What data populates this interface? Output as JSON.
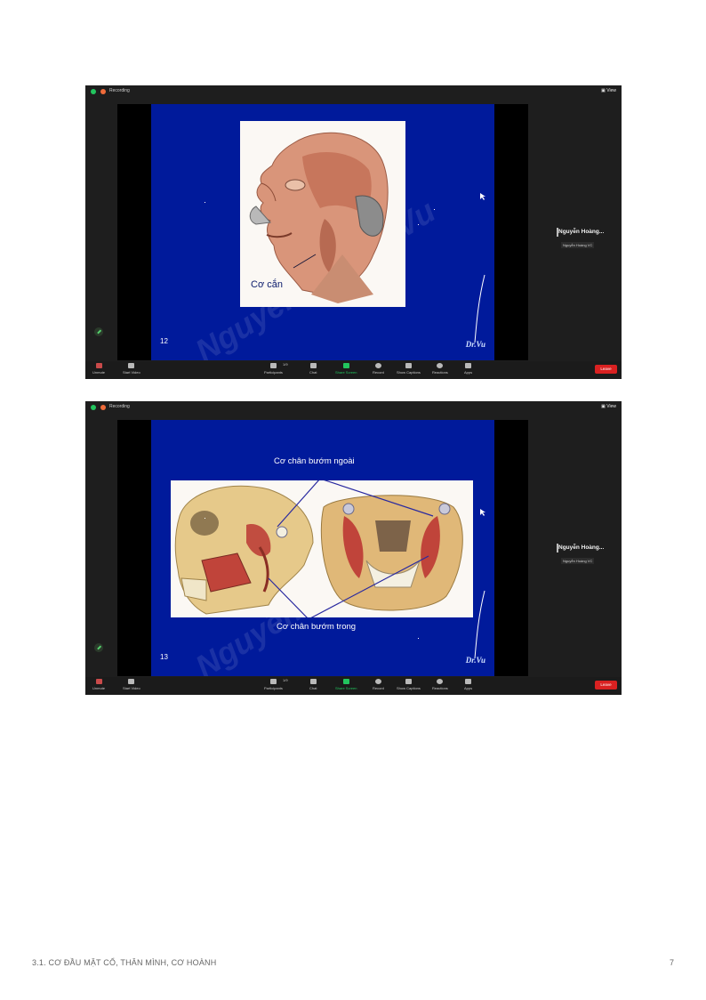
{
  "screens": [
    {
      "recording_label": "Recording",
      "view_label": "View",
      "slide_number": "12",
      "slide_caption": "Cơ cắn",
      "watermark": "Nguyễn Hoàng Vu",
      "signature": "Dr.Vu",
      "participant_name": "Nguyễn Hoàng...",
      "participant_sub": "Nguyễn Hoàng VC"
    },
    {
      "recording_label": "Recording",
      "view_label": "View",
      "slide_number": "13",
      "label_top": "Cơ chân bướm ngoài",
      "label_bottom": "Cơ chân bướm trong",
      "watermark": "Nguyễn Hoàng Vu",
      "signature": "Dr.Vu",
      "participant_name": "Nguyễn Hoàng...",
      "participant_sub": "Nguyễn Hoàng VC"
    }
  ],
  "toolbar": {
    "unmute": "Unmute",
    "start_video": "Start Video",
    "participants": "Participants",
    "participants_count": "1/9",
    "chat": "Chat",
    "share_screen": "Share Screen",
    "record": "Record",
    "show_captions": "Show Captions",
    "reactions": "Reactions",
    "apps": "Apps",
    "leave": "Leave"
  },
  "footer": {
    "title": "3.1. CƠ ĐẦU MẶT CỔ, THÂN MÌNH, CƠ HOÀNH",
    "page": "7"
  }
}
